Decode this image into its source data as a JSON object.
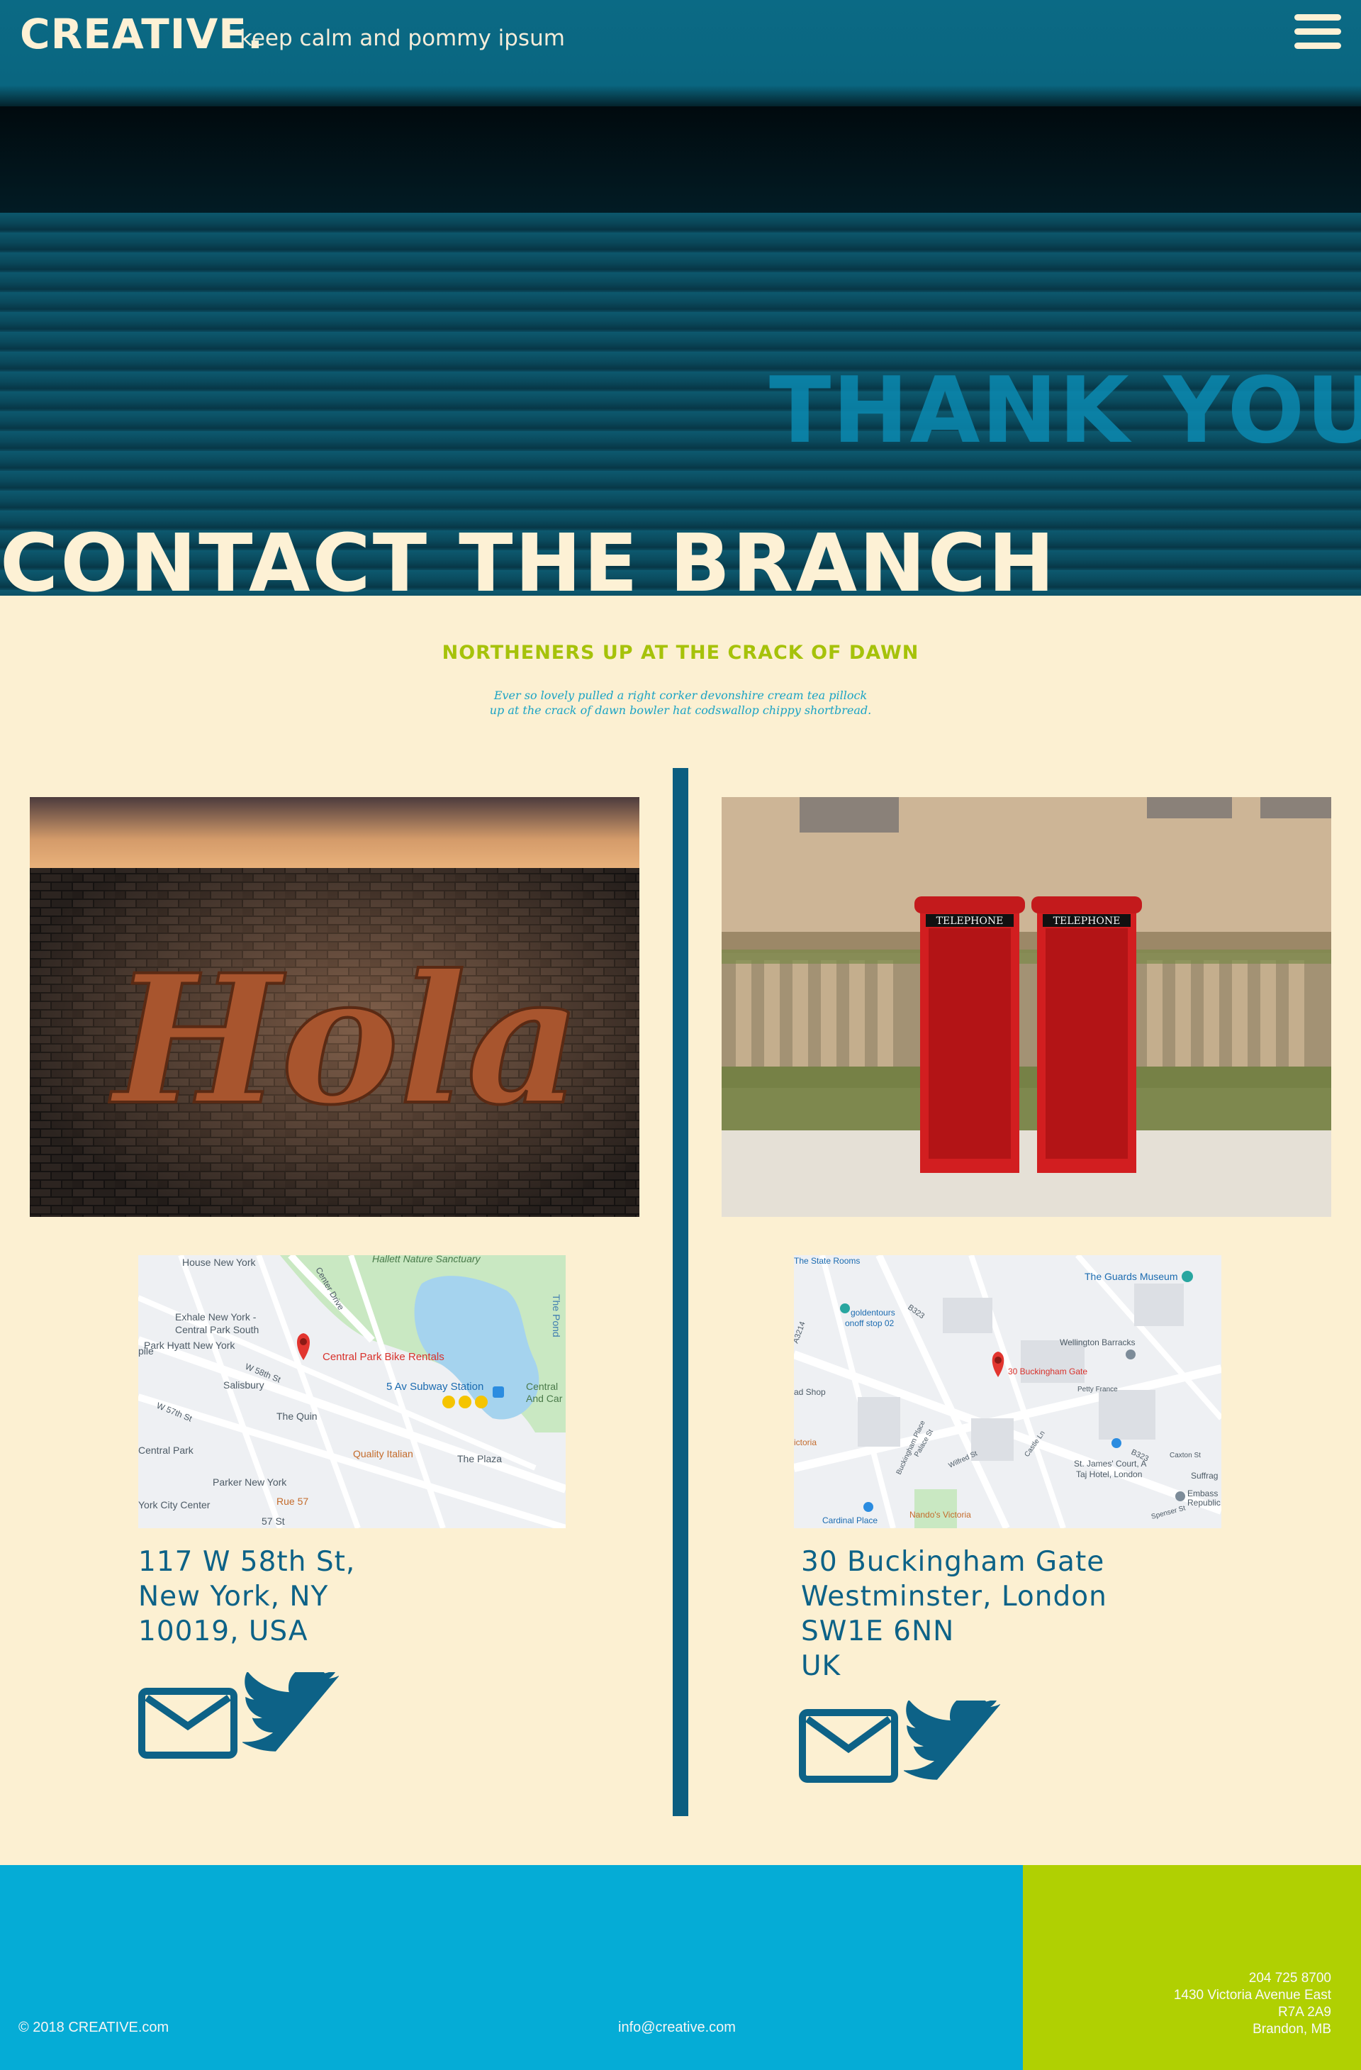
{
  "header": {
    "brand": "CREATIVE.",
    "tagline": "keep calm and pommy ipsum",
    "menu_icon": "hamburger-menu-icon"
  },
  "hero": {
    "sign_text": "THANK YOU",
    "title": "CONTACT THE BRANCH"
  },
  "intro": {
    "subheading": "NORTHENERS UP AT THE CRACK OF DAWN",
    "body_line1": "Ever so lovely pulled a right corker devonshire cream tea pillock",
    "body_line2": "up at the crack of dawn bowler hat codswallop chippy shortbread."
  },
  "branches": [
    {
      "photo_sign": "Hola",
      "map": {
        "labels": {
          "house": "House New York",
          "sanctuary": "Hallett Nature Sanctuary",
          "exhale": "Exhale New York -",
          "exhale2": "Central Park South",
          "hyatt": "Park Hyatt New York",
          "marker": "Central Park Bike Rentals",
          "subway": "5 Av Subway Station",
          "salisbury": "Salisbury",
          "quin": "The Quin",
          "quality": "Quality Italian",
          "plaza": "The Plaza",
          "parker": "Parker New York",
          "rue": "Rue 57",
          "city": "York City Center",
          "central_park": "Central Park",
          "pond": "The Pond",
          "st58": "W 58th St",
          "st57": "W 57th St",
          "st57b": "57 St",
          "centre_drive": "Center Drive",
          "zoo": "Central",
          "zoo2": "And Car",
          "pile": "pile"
        }
      },
      "address": [
        "117 W 58th St,",
        "New York, NY",
        "10019, USA"
      ],
      "icons": [
        "envelope-icon",
        "twitter-bird-icon"
      ]
    },
    {
      "photo_sign": "TELEPHONE",
      "map": {
        "labels": {
          "rooms": "The State Rooms",
          "museum": "The Guards Museum",
          "goldentours": "goldentours",
          "goldentours2": "onoff stop 02",
          "barracks": "Wellington Barracks",
          "marker": "30 Buckingham Gate",
          "shop": "ad Shop",
          "victoria": "ictoria",
          "petty": "Petty France",
          "stjames": "St. James' Court, A",
          "stjames2": "Taj Hotel, London",
          "place": "Cardinal Place",
          "nandos": "Nando's Victoria",
          "embassy": "Embass",
          "embassy2": "Republic",
          "suffrag": "Suffrag",
          "b323": "B323",
          "b323b": "B323",
          "a3214": "A3214",
          "buck": "Buckingham Place",
          "castle": "Castle Ln",
          "palace": "Palace St",
          "wilfred": "Wilfred St",
          "spenser": "Spenser St",
          "caxton": "Caxton St"
        }
      },
      "address": [
        "30 Buckingham Gate",
        "Westminster, London",
        "SW1E 6NN",
        "UK"
      ],
      "icons": [
        "envelope-icon",
        "twitter-bird-icon"
      ]
    }
  ],
  "footer": {
    "copyright": "© 2018 CREATIVE.com",
    "email": "info@creative.com",
    "phone": "204 725 8700",
    "street": "1430 Victoria Avenue East",
    "postal": "R7A 2A9",
    "city": "Brandon, MB"
  },
  "colors": {
    "accent_blue": "#0d6287",
    "accent_green": "#a6c20a",
    "cream": "#fcf0d2",
    "footer_blue": "#05acd6",
    "footer_green": "#b0d002"
  }
}
